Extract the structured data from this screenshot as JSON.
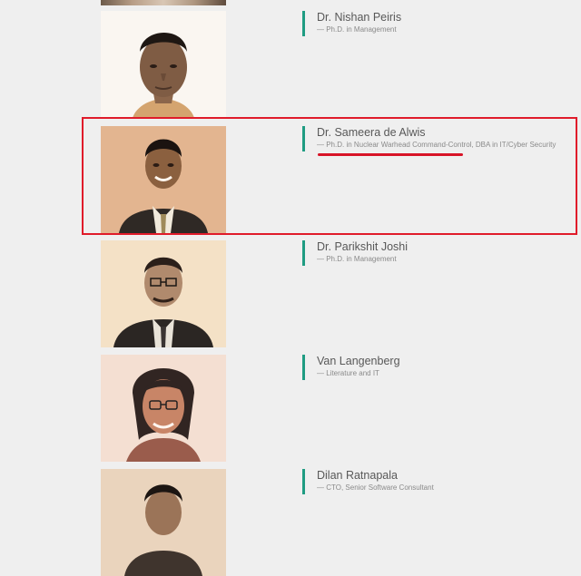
{
  "profiles": [
    {
      "name": "Dr. Nishan Peiris",
      "title": "— Ph.D. in Management"
    },
    {
      "name": "Dr. Sameera de Alwis",
      "title": "— Ph.D. in Nuclear Warhead Command-Control, DBA in IT/Cyber Security"
    },
    {
      "name": "Dr. Parikshit Joshi",
      "title": "— Ph.D. in Management"
    },
    {
      "name": "Van Langenberg",
      "title": "— Literature and IT"
    },
    {
      "name": "Dilan Ratnapala",
      "title": "— CTO, Senior Software Consultant"
    }
  ],
  "colors": {
    "accent_bar": "#1f9c82",
    "highlight": "#e01b2a",
    "background": "#efefef"
  }
}
